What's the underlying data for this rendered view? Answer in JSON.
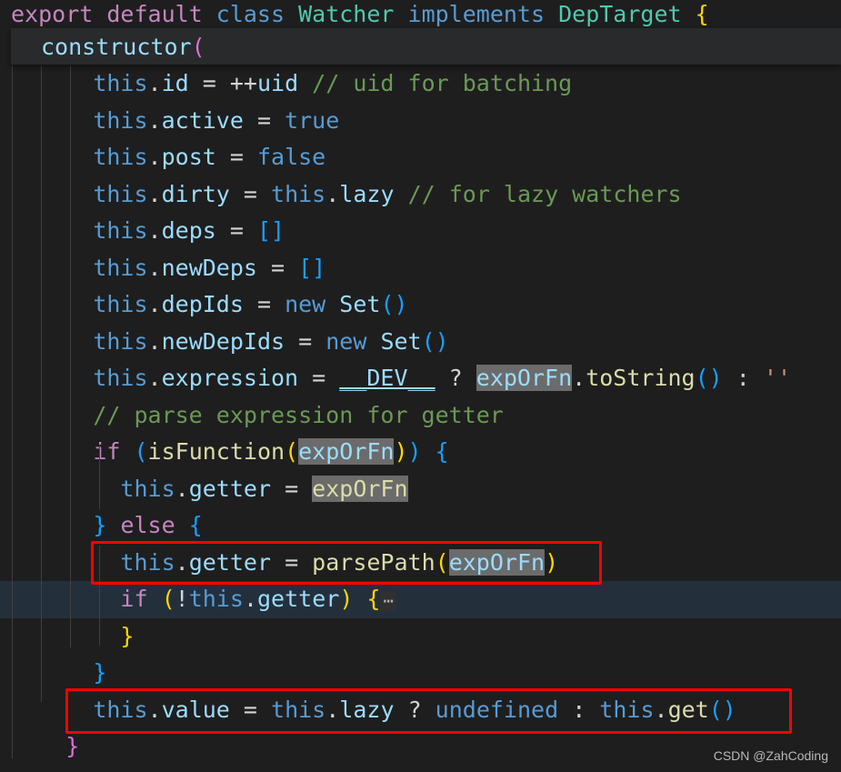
{
  "editor": {
    "theme_background": "#1e1e1e",
    "current_line_background": "#23303c",
    "selection_highlight_color": "#6b6b6b",
    "annotation_color": "#ff0000",
    "language": "TypeScript"
  },
  "sticky": {
    "line1": {
      "t1": "export default ",
      "t2": "class ",
      "t3": "Watcher ",
      "t4": "implements ",
      "t5": "DepTarget ",
      "t6": "{"
    },
    "line2": {
      "t1": "constructor",
      "t2": "("
    }
  },
  "code_lines": [
    {
      "id": "line-this-id",
      "text": "    this.id = ++uid // uid for batching"
    },
    {
      "id": "line-this-active",
      "text": "    this.active = true"
    },
    {
      "id": "line-this-post",
      "text": "    this.post = false"
    },
    {
      "id": "line-this-dirty",
      "text": "    this.dirty = this.lazy // for lazy watchers"
    },
    {
      "id": "line-this-deps",
      "text": "    this.deps = []"
    },
    {
      "id": "line-this-newdeps",
      "text": "    this.newDeps = []"
    },
    {
      "id": "line-this-depids",
      "text": "    this.depIds = new Set()"
    },
    {
      "id": "line-this-newdepids",
      "text": "    this.newDepIds = new Set()"
    },
    {
      "id": "line-this-expression",
      "text": "    this.expression = __DEV__ ? expOrFn.toString() : ''"
    },
    {
      "id": "line-comment-parse",
      "text": "    // parse expression for getter"
    },
    {
      "id": "line-if-isfunction",
      "text": "    if (isFunction(expOrFn)) {"
    },
    {
      "id": "line-getter-expOrFn",
      "text": "      this.getter = expOrFn"
    },
    {
      "id": "line-else",
      "text": "    } else {"
    },
    {
      "id": "line-getter-parsepath",
      "text": "      this.getter = parsePath(expOrFn)"
    },
    {
      "id": "line-if-not-getter",
      "text": "      if (!this.getter) {⋯"
    },
    {
      "id": "line-close-inner",
      "text": "      }"
    },
    {
      "id": "line-close-else",
      "text": "    }"
    },
    {
      "id": "line-this-value",
      "text": "    this.value = this.lazy ? undefined : this.get()"
    },
    {
      "id": "line-close-ctor",
      "text": "  }"
    }
  ],
  "tokens": {
    "export_default": "export default ",
    "class_kw": "class ",
    "watcher": "Watcher ",
    "implements_kw": "implements ",
    "deptarget": "DepTarget ",
    "brace_open": "{",
    "constructor": "constructor",
    "paren_open": "(",
    "this": "this",
    "dot": ".",
    "id": "id",
    "eq": " = ",
    "plusplus": "++",
    "uid": "uid",
    "comment_uid": " // uid for batching",
    "active": "active",
    "true": "true",
    "post": "post",
    "false": "false",
    "dirty": "dirty",
    "lazy": "lazy",
    "comment_lazy": " // for lazy watchers",
    "deps": "deps",
    "bracket_empty": "[]",
    "newDeps": "newDeps",
    "depIds": "depIds",
    "new_kw": "new ",
    "Set": "Set",
    "parens_empty": "()",
    "newDepIds": "newDepIds",
    "expression": "expression",
    "dev": "__DEV__",
    "question": " ? ",
    "expOrFn": "expOrFn",
    "toString": "toString",
    "colon": " : ",
    "empty_string": "''",
    "comment_parse": "// parse expression for getter",
    "if_kw": "if",
    "space": " ",
    "isFunction": "isFunction",
    "paren_close": ")",
    "double_paren_close": "))",
    "brace_open_sp": " {",
    "getter": "getter",
    "brace_close": "}",
    "else_kw": "else",
    "parsePath": "parsePath",
    "bang": "!",
    "fold_ellipsis": "⋯",
    "value": "value",
    "undefined": "undefined",
    "get": "get"
  },
  "watermark": "CSDN @ZahCoding"
}
